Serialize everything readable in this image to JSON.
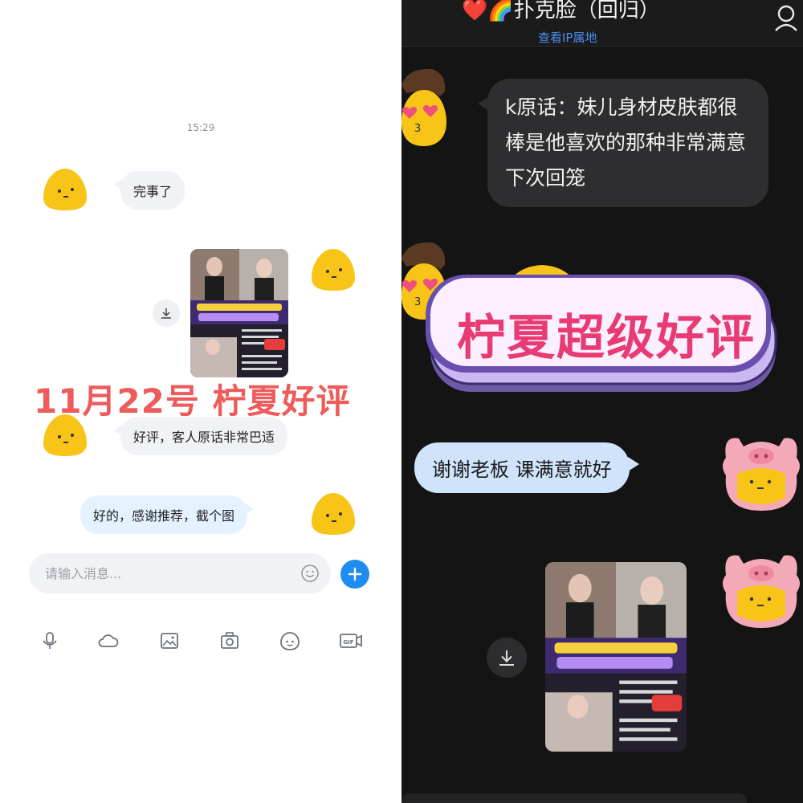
{
  "left_chat": {
    "timestamp": "15:29",
    "messages": [
      {
        "sender": "other",
        "text": "完事了"
      },
      {
        "sender": "self",
        "type": "image"
      },
      {
        "sender": "other",
        "text": "好评，客人原话非常巴适"
      },
      {
        "sender": "self",
        "text": "好的，感谢推荐，截个图"
      }
    ],
    "overlay_title": "11月22号   柠夏好评",
    "input": {
      "placeholder": "请输入消息..."
    },
    "toolbar_icons": [
      "microphone-icon",
      "cloud-icon",
      "image-icon",
      "camera-icon",
      "emoji-icon",
      "gif-icon"
    ],
    "accent_color": "#1f8df0"
  },
  "right_chat": {
    "header": {
      "name": "❤️🌈扑克脸（回归）",
      "ip_link": "查看IP属地"
    },
    "messages": [
      {
        "sender": "other",
        "text": "k原话：妹儿身材皮肤都很棒是他喜欢的那种非常满意下次回笼"
      },
      {
        "sender": "other",
        "type": "sticker",
        "text": "柠夏超级好评"
      },
      {
        "sender": "self",
        "text": "谢谢老板  课满意就好"
      },
      {
        "sender": "self",
        "type": "image"
      }
    ],
    "accent_color": "#cfe3fa"
  }
}
